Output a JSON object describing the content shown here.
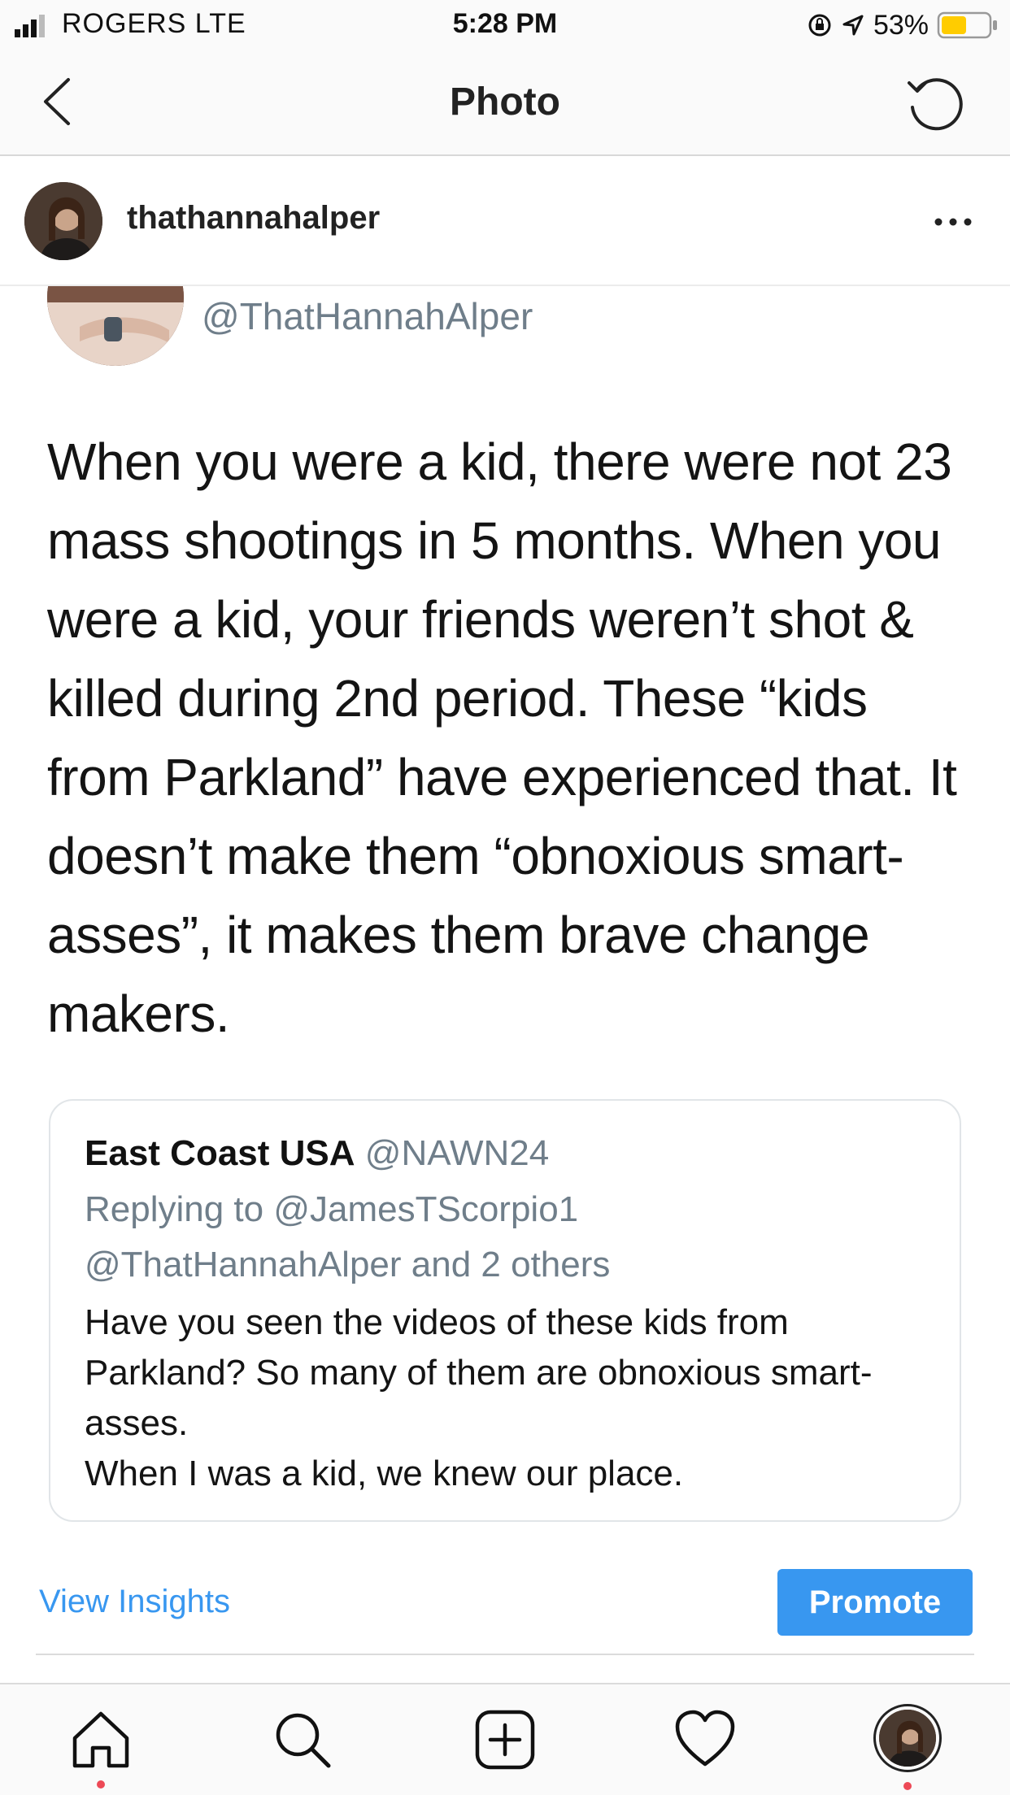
{
  "status_bar": {
    "carrier": "ROGERS  LTE",
    "time": "5:28 PM",
    "battery": "53%",
    "battery_level": 0.53,
    "battery_color": "#ffcc00"
  },
  "nav": {
    "title": "Photo",
    "back_icon": "chevron-left-icon",
    "refresh_icon": "rotate-ccw-icon"
  },
  "post": {
    "username": "thathannahalper",
    "more_icon": "more-horizontal-icon"
  },
  "tweet": {
    "handle": "@ThatHannahAlper",
    "body": "When you were a kid, there were not 23 mass shootings in 5 months. When you were a kid, your friends weren’t shot & killed during 2nd period. These “kids from Parkland” have experienced that. It doesn’t make them “obnoxious smart-asses”, it makes them brave change makers."
  },
  "quote": {
    "name": "East Coast USA",
    "handle": "@NAWN24",
    "replying_line1": "Replying to @JamesTScorpio1",
    "replying_line2": "@ThatHannahAlper and 2 others",
    "text_line1": "Have you seen the videos of these kids from Parkland? So many of them are obnoxious smart-asses.",
    "text_line2": "When I was a kid, we knew our place."
  },
  "actions": {
    "insights": "View Insights",
    "promote": "Promote",
    "accent": "#3897f0"
  },
  "tabs": [
    "home-icon",
    "search-icon",
    "add-post-icon",
    "heart-icon",
    "profile-avatar"
  ]
}
